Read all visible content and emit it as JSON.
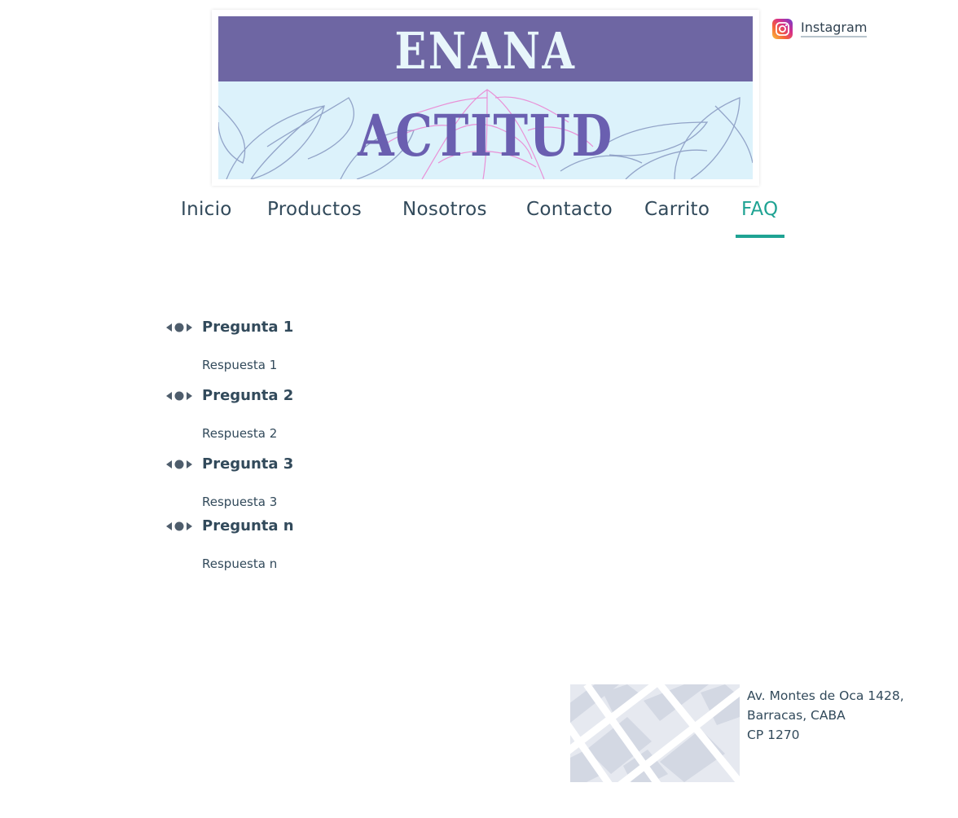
{
  "banner": {
    "line1": "ENANA",
    "line2": "ACTITUD"
  },
  "social": {
    "label": "Instagram",
    "icon": "instagram-icon"
  },
  "nav": {
    "items": [
      {
        "label": "Inicio"
      },
      {
        "label": "Productos"
      },
      {
        "label": "Nosotros"
      },
      {
        "label": "Contacto"
      },
      {
        "label": "Carrito"
      },
      {
        "label": "FAQ"
      }
    ],
    "active": "FAQ",
    "accent_color": "#1fa393"
  },
  "faq": {
    "items": [
      {
        "question": "Pregunta 1",
        "answer": "Respuesta 1"
      },
      {
        "question": "Pregunta 2",
        "answer": "Respuesta 2"
      },
      {
        "question": "Pregunta 3",
        "answer": "Respuesta 3"
      },
      {
        "question": "Pregunta n",
        "answer": "Respuesta n"
      }
    ]
  },
  "footer": {
    "address_line1": "Av. Montes de Oca 1428,",
    "address_line2": "Barracas, CABA",
    "postal_code": "CP 1270"
  },
  "colors": {
    "text": "#2f4150",
    "banner_purple": "#6e66a3",
    "banner_light": "#dcf2fb"
  }
}
